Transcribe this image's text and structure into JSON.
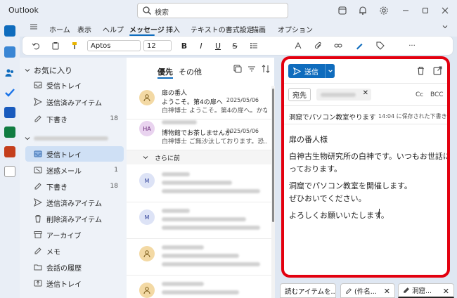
{
  "window": {
    "title": "Outlook",
    "search_placeholder": "検索"
  },
  "ribbon_tabs": [
    "ホーム",
    "表示",
    "ヘルプ",
    "メッセージ",
    "挿入",
    "テキストの書式設定",
    "描画",
    "オプション"
  ],
  "active_tab": "メッセージ",
  "toolbar": {
    "font_name": "Aptos",
    "font_size": "12",
    "bold": "B",
    "italic": "I",
    "underline": "U",
    "strikethrough": "S",
    "more": "···"
  },
  "folder_pane": {
    "favorites_header": "お気に入り",
    "favorites": [
      {
        "label": "受信トレイ",
        "icon": "inbox-icon",
        "count": ""
      },
      {
        "label": "送信済みアイテム",
        "icon": "send-icon",
        "count": ""
      },
      {
        "label": "下書き",
        "icon": "pencil-icon",
        "count": "18"
      }
    ],
    "folders": [
      {
        "label": "受信トレイ",
        "icon": "inbox-icon",
        "count": "",
        "selected": true
      },
      {
        "label": "迷惑メール",
        "icon": "junk-icon",
        "count": "1"
      },
      {
        "label": "下書き",
        "icon": "pencil-icon",
        "count": "18"
      },
      {
        "label": "送信済みアイテム",
        "icon": "send-icon",
        "count": ""
      },
      {
        "label": "削除済みアイテム",
        "icon": "trash-icon",
        "count": ""
      },
      {
        "label": "アーカイブ",
        "icon": "archive-icon",
        "count": ""
      },
      {
        "label": "メモ",
        "icon": "note-icon",
        "count": ""
      },
      {
        "label": "会話の履歴",
        "icon": "folder-icon",
        "count": ""
      },
      {
        "label": "送信トレイ",
        "icon": "outbox-icon",
        "count": ""
      }
    ]
  },
  "message_list": {
    "tabs": [
      "優先",
      "その他"
    ],
    "active_tab": "優先",
    "messages": [
      {
        "sender": "扉の番人",
        "subject": "ようこそ。第4の扉へ",
        "date": "2025/05/06",
        "preview": "白神博士 ようこそ。第4の扉へ。かな...",
        "avatar": "",
        "avatar_icon": "person-icon",
        "avatar_color": "#f3d9a4"
      },
      {
        "sender": "",
        "subject": "博物館でお茶しませんか",
        "date": "2025/05/06",
        "preview": "白神博士 ご無沙汰しております。恐...",
        "avatar": "HA",
        "avatar_icon": "",
        "avatar_color": "#e9d3ef"
      }
    ],
    "section_header": "さらに前",
    "older_avatars": [
      {
        "avatar": "M",
        "color": "#dde3f6"
      },
      {
        "avatar": "M",
        "color": "#dde3f6"
      },
      {
        "avatar": "",
        "color": "#f3d9a4"
      },
      {
        "avatar": "",
        "color": "#f3d9a4"
      }
    ]
  },
  "compose": {
    "send_label": "送信",
    "to_label": "宛先",
    "cc_label": "Cc",
    "bcc_label": "BCC",
    "subject": "洞窟でパソコン教室やります",
    "saved_status": "14:04 に保存された下書き",
    "body_lines": [
      "扉の番人様",
      "",
      "白神古生物研究所の白神です。いつもお世話にな",
      "っております。",
      "",
      "洞窟でパソコン教室を開催します。",
      "ぜひおいでください。",
      "",
      "よろしくお願いいたします。"
    ]
  },
  "draft_tabs": [
    "読むアイテムを...",
    "(件名...",
    "洞窟..."
  ],
  "colors": {
    "accent": "#0f6cbd",
    "highlight": "#e3000f",
    "selected_folder": "#cfe0f5"
  }
}
